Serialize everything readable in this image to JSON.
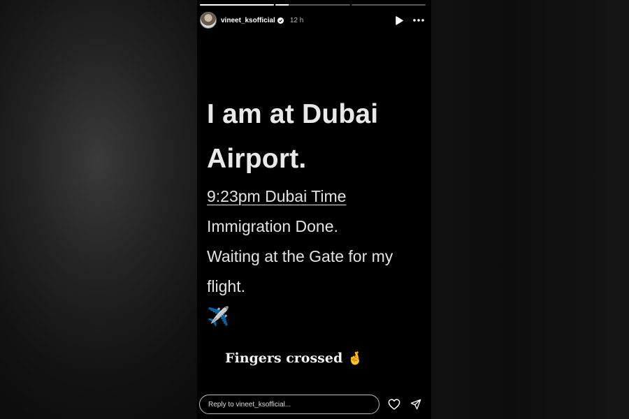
{
  "story": {
    "progress": [
      1.0,
      0.18,
      0.0
    ],
    "user": {
      "username": "vineet_ksofficial",
      "verified": true,
      "time_ago": "12 h"
    },
    "controls": {
      "play_icon": "play-icon",
      "more_icon": "more-options-icon"
    },
    "content": {
      "title_line1": "I am at Dubai",
      "title_line2": "Airport.",
      "time_line": "9:23pm Dubai Time",
      "line2": "Immigration Done.",
      "line3": "Waiting at the Gate for my",
      "line4": "flight.",
      "emoji": "✈️"
    },
    "sticker": {
      "text": "Fingers crossed",
      "emoji": "🤞"
    },
    "footer": {
      "reply_placeholder": "Reply to vineet_ksofficial...",
      "like_icon": "heart-icon",
      "share_icon": "send-icon"
    }
  },
  "colors": {
    "story_background": "#000000",
    "text": "#e9e9e9",
    "page_background": "#0c0c0c"
  }
}
